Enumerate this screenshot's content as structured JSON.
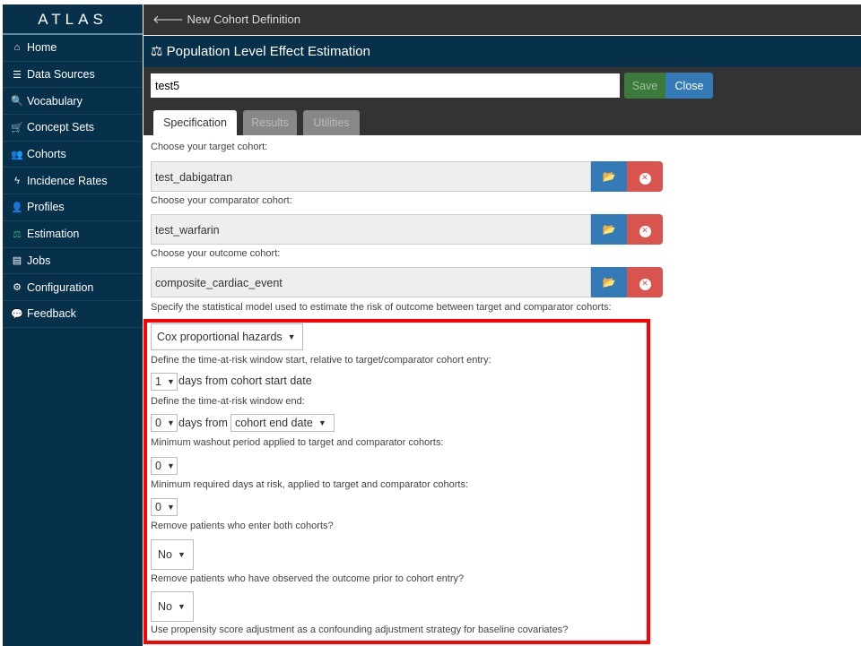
{
  "sidebar": {
    "logo": "ATLAS",
    "items": [
      {
        "label": "Home",
        "icon": "home-icon",
        "glyph": "⌂"
      },
      {
        "label": "Data Sources",
        "icon": "database-icon",
        "glyph": "☰"
      },
      {
        "label": "Vocabulary",
        "icon": "search-icon",
        "glyph": "🔍"
      },
      {
        "label": "Concept Sets",
        "icon": "cart-icon",
        "glyph": "🛒"
      },
      {
        "label": "Cohorts",
        "icon": "users-icon",
        "glyph": "👥"
      },
      {
        "label": "Incidence Rates",
        "icon": "bolt-icon",
        "glyph": "ϟ"
      },
      {
        "label": "Profiles",
        "icon": "user-icon",
        "glyph": "👤"
      },
      {
        "label": "Estimation",
        "icon": "balance-scale-icon",
        "glyph": "⚖",
        "active": true
      },
      {
        "label": "Jobs",
        "icon": "tasks-icon",
        "glyph": "▤"
      },
      {
        "label": "Configuration",
        "icon": "cogs-icon",
        "glyph": "⚙"
      },
      {
        "label": "Feedback",
        "icon": "comment-icon",
        "glyph": "💬"
      }
    ]
  },
  "topbar": {
    "back_label": "New Cohort Definition",
    "icon": "arrow-left-icon"
  },
  "title": {
    "text": "Population Level Effect Estimation",
    "icon": "balance-scale-icon"
  },
  "editor": {
    "name_value": "test5",
    "save_label": "Save",
    "close_label": "Close"
  },
  "tabs": [
    {
      "label": "Specification",
      "active": true
    },
    {
      "label": "Results"
    },
    {
      "label": "Utilities"
    }
  ],
  "cohorts": {
    "target_label": "Choose your target cohort:",
    "target_value": "test_dabigatran",
    "comparator_label": "Choose your comparator cohort:",
    "comparator_value": "test_warfarin",
    "outcome_label": "Choose your outcome cohort:",
    "outcome_value": "composite_cardiac_event"
  },
  "spec": {
    "model_label": "Specify the statistical model used to estimate the risk of outcome between target and comparator cohorts:",
    "model_value": "Cox proportional hazards",
    "tar_start_label": "Define the time-at-risk window start, relative to target/comparator cohort entry:",
    "tar_start_value": "1",
    "tar_start_suffix": "days from cohort start date",
    "tar_end_label": "Define the time-at-risk window end:",
    "tar_end_value": "0",
    "tar_end_mid": "days from",
    "tar_end_anchor": "cohort end date",
    "washout_label": "Minimum washout period applied to target and comparator cohorts:",
    "washout_value": "0",
    "min_days_label": "Minimum required days at risk, applied to target and comparator cohorts:",
    "min_days_value": "0",
    "remove_both_label": "Remove patients who enter both cohorts?",
    "remove_both_value": "No",
    "remove_prior_label": "Remove patients who have observed the outcome prior to cohort entry?",
    "remove_prior_value": "No",
    "ps_label": "Use propensity score adjustment as a confounding adjustment strategy for baseline covariates?"
  },
  "colors": {
    "sidebar": "#07304a",
    "save": "#3b7a3b",
    "close": "#337ab7",
    "delete": "#d9534f",
    "highlight": "#ff0000"
  }
}
